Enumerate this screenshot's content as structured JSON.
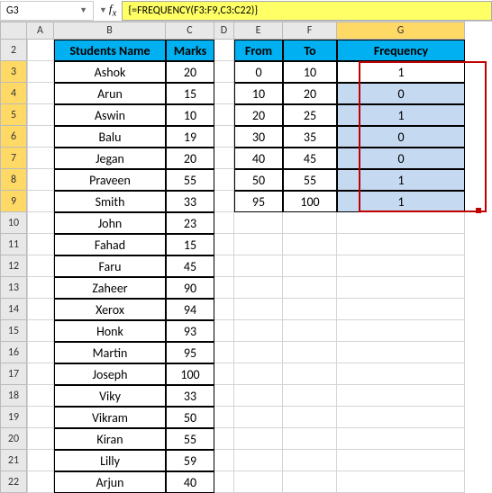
{
  "nameBox": "G3",
  "formulaBar": "{=FREQUENCY(F3:F9,C3:C22)}",
  "columns": [
    "A",
    "B",
    "C",
    "D",
    "E",
    "F",
    "G"
  ],
  "rowStart": 2,
  "rowEnd": 22,
  "headers1": {
    "B": "Students Name",
    "C": "Marks"
  },
  "headers2": {
    "E": "From",
    "F": "To",
    "G": "Frequency"
  },
  "students": [
    {
      "name": "Ashok",
      "marks": 20
    },
    {
      "name": "Arun",
      "marks": 15
    },
    {
      "name": "Aswin",
      "marks": 10
    },
    {
      "name": "Balu",
      "marks": 19
    },
    {
      "name": "Jegan",
      "marks": 20
    },
    {
      "name": "Praveen",
      "marks": 55
    },
    {
      "name": "Smith",
      "marks": 33
    },
    {
      "name": "John",
      "marks": 23
    },
    {
      "name": "Fahad",
      "marks": 15
    },
    {
      "name": "Faru",
      "marks": 45
    },
    {
      "name": "Zaheer",
      "marks": 90
    },
    {
      "name": "Xerox",
      "marks": 94
    },
    {
      "name": "Honk",
      "marks": 93
    },
    {
      "name": "Martin",
      "marks": 95
    },
    {
      "name": "Joseph",
      "marks": 100
    },
    {
      "name": "Viky",
      "marks": 33
    },
    {
      "name": "Vikram",
      "marks": 50
    },
    {
      "name": "Kiran",
      "marks": 55
    },
    {
      "name": "Lilly",
      "marks": 59
    },
    {
      "name": "Arjun",
      "marks": 40
    }
  ],
  "bins": [
    {
      "from": 0,
      "to": 10,
      "freq": 1
    },
    {
      "from": 10,
      "to": 20,
      "freq": 0
    },
    {
      "from": 20,
      "to": 25,
      "freq": 1
    },
    {
      "from": 30,
      "to": 35,
      "freq": 0
    },
    {
      "from": 40,
      "to": 45,
      "freq": 0
    },
    {
      "from": 50,
      "to": 55,
      "freq": 1
    },
    {
      "from": 95,
      "to": 100,
      "freq": 1
    }
  ],
  "selectedCell": "G3",
  "selectedCol": "G"
}
